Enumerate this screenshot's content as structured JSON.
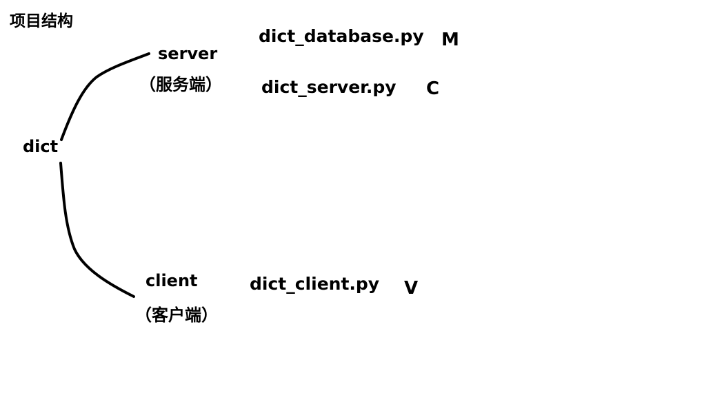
{
  "title": "项目结构",
  "root": {
    "label": "dict"
  },
  "branches": [
    {
      "label": "server",
      "sublabel": "（服务端）",
      "file": "dict_database.py",
      "role": "M"
    },
    {
      "file": "dict_server.py",
      "role": "C"
    },
    {
      "label": "client",
      "sublabel": "（客户端）",
      "file": "dict_client.py",
      "role": "V"
    }
  ],
  "colors": {
    "ink": "#000000",
    "background": "#ffffff"
  }
}
